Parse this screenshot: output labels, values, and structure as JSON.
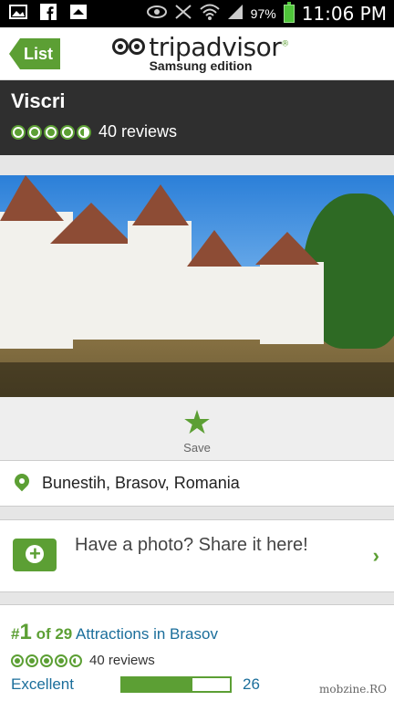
{
  "status_bar": {
    "battery_percent": "97%",
    "time": "11:06 PM",
    "icons": [
      "image-icon",
      "facebook-icon",
      "notification-icon",
      "eye-icon",
      "signal-mute-icon",
      "wifi-icon",
      "cell-signal-icon",
      "battery-icon"
    ]
  },
  "header": {
    "back_label": "List",
    "logo_text": "tripadvisor",
    "logo_edition": "Samsung edition",
    "trademark": "®"
  },
  "place": {
    "name": "Viscri",
    "rating": 4.5,
    "reviews": "40 reviews"
  },
  "actions": {
    "save_label": "Save"
  },
  "location": {
    "address": "Bunestih, Brasov, Romania"
  },
  "photo_prompt": {
    "text": "Have a photo? Share it here!"
  },
  "ranking": {
    "hash": "#",
    "rank": "1",
    "of_total": "of 29",
    "category": "Attractions in Brasov",
    "reviews": "40 reviews",
    "excellent_label": "Excellent",
    "excellent_count": "26",
    "excellent_fraction": 0.65
  },
  "watermark": "mobzine.RO",
  "colors": {
    "brand_green": "#5c9f34",
    "link_blue": "#1b6e9b",
    "title_bar": "#2f2f2f"
  }
}
